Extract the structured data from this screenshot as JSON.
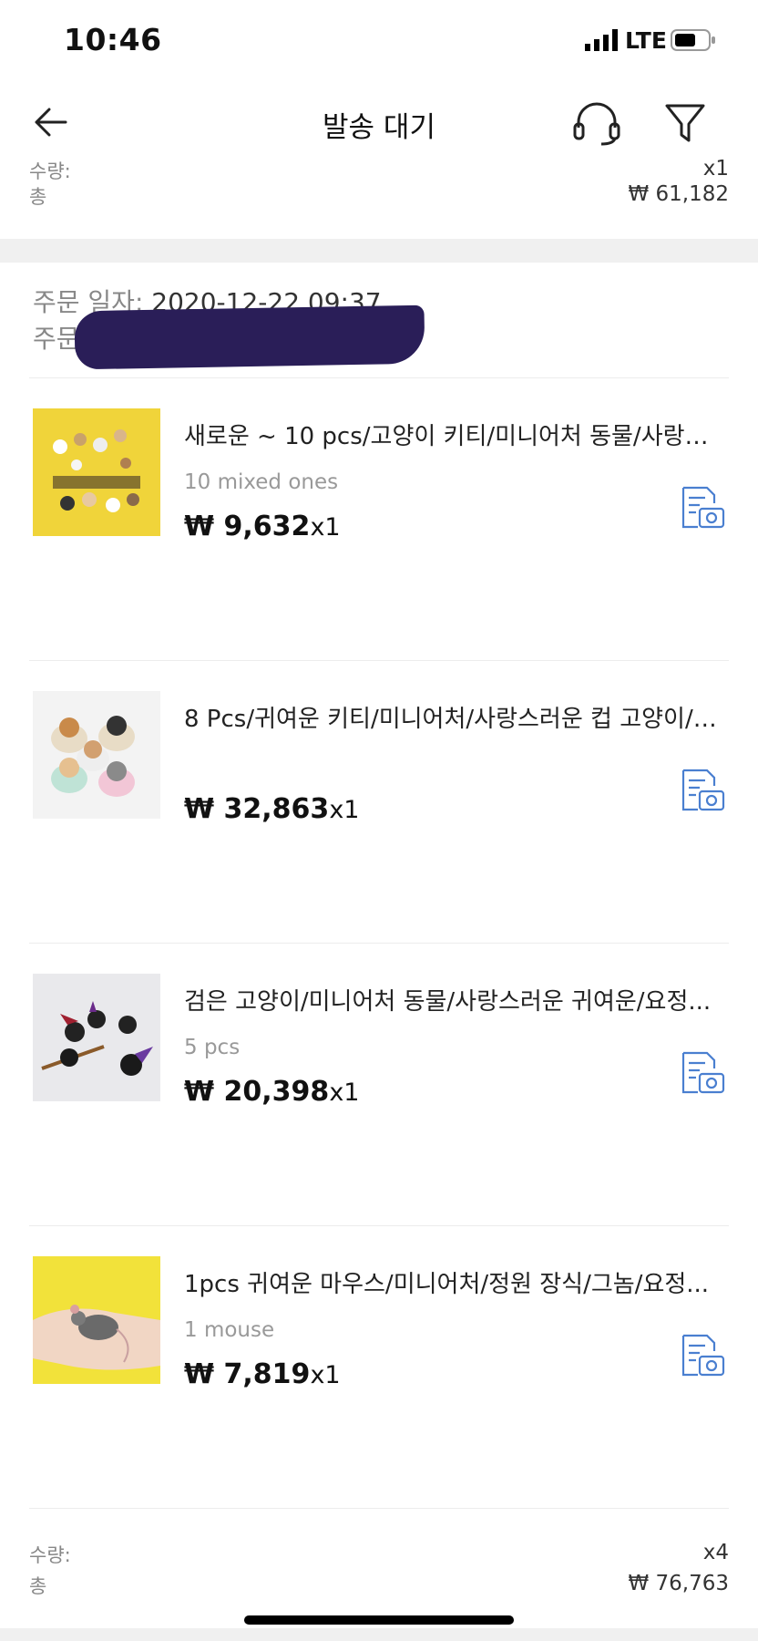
{
  "status_bar": {
    "time": "10:46",
    "network": "LTE"
  },
  "nav": {
    "title": "발송 대기",
    "icons": [
      "back-arrow-icon",
      "headset-icon",
      "filter-icon"
    ]
  },
  "previous_order": {
    "qty_label": "수량:",
    "qty_value": "x1",
    "total_label": "총",
    "total_value": "₩ 61,182"
  },
  "order": {
    "date_label": "주문 일자:",
    "date_value": "2020-12-22 09:37",
    "number_label": "주문",
    "items": [
      {
        "title": "새로운 ~ 10 pcs/고양이 키티/미니어처 동물/사랑…",
        "variant": "10 mixed ones",
        "price": "₩ 9,632",
        "qty": "x1"
      },
      {
        "title": "8 Pcs/귀여운 키티/미니어처/사랑스러운 컵 고양이/…",
        "variant": "",
        "price": "₩ 32,863",
        "qty": "x1"
      },
      {
        "title": "검은 고양이/미니어처 동물/사랑스러운 귀여운/요정...",
        "variant": "5 pcs",
        "price": "₩ 20,398",
        "qty": "x1"
      },
      {
        "title": "1pcs 귀여운 마우스/미니어처/정원 장식/그놈/요정...",
        "variant": "1 mouse",
        "price": "₩ 7,819",
        "qty": "x1"
      }
    ],
    "summary": {
      "qty_label": "수량:",
      "qty_value": "x4",
      "total_label": "총",
      "total_value": "₩ 76,763"
    }
  },
  "colors": {
    "accent": "#4a7fd0",
    "muted": "#888888",
    "separator": "#f0f0f0"
  }
}
